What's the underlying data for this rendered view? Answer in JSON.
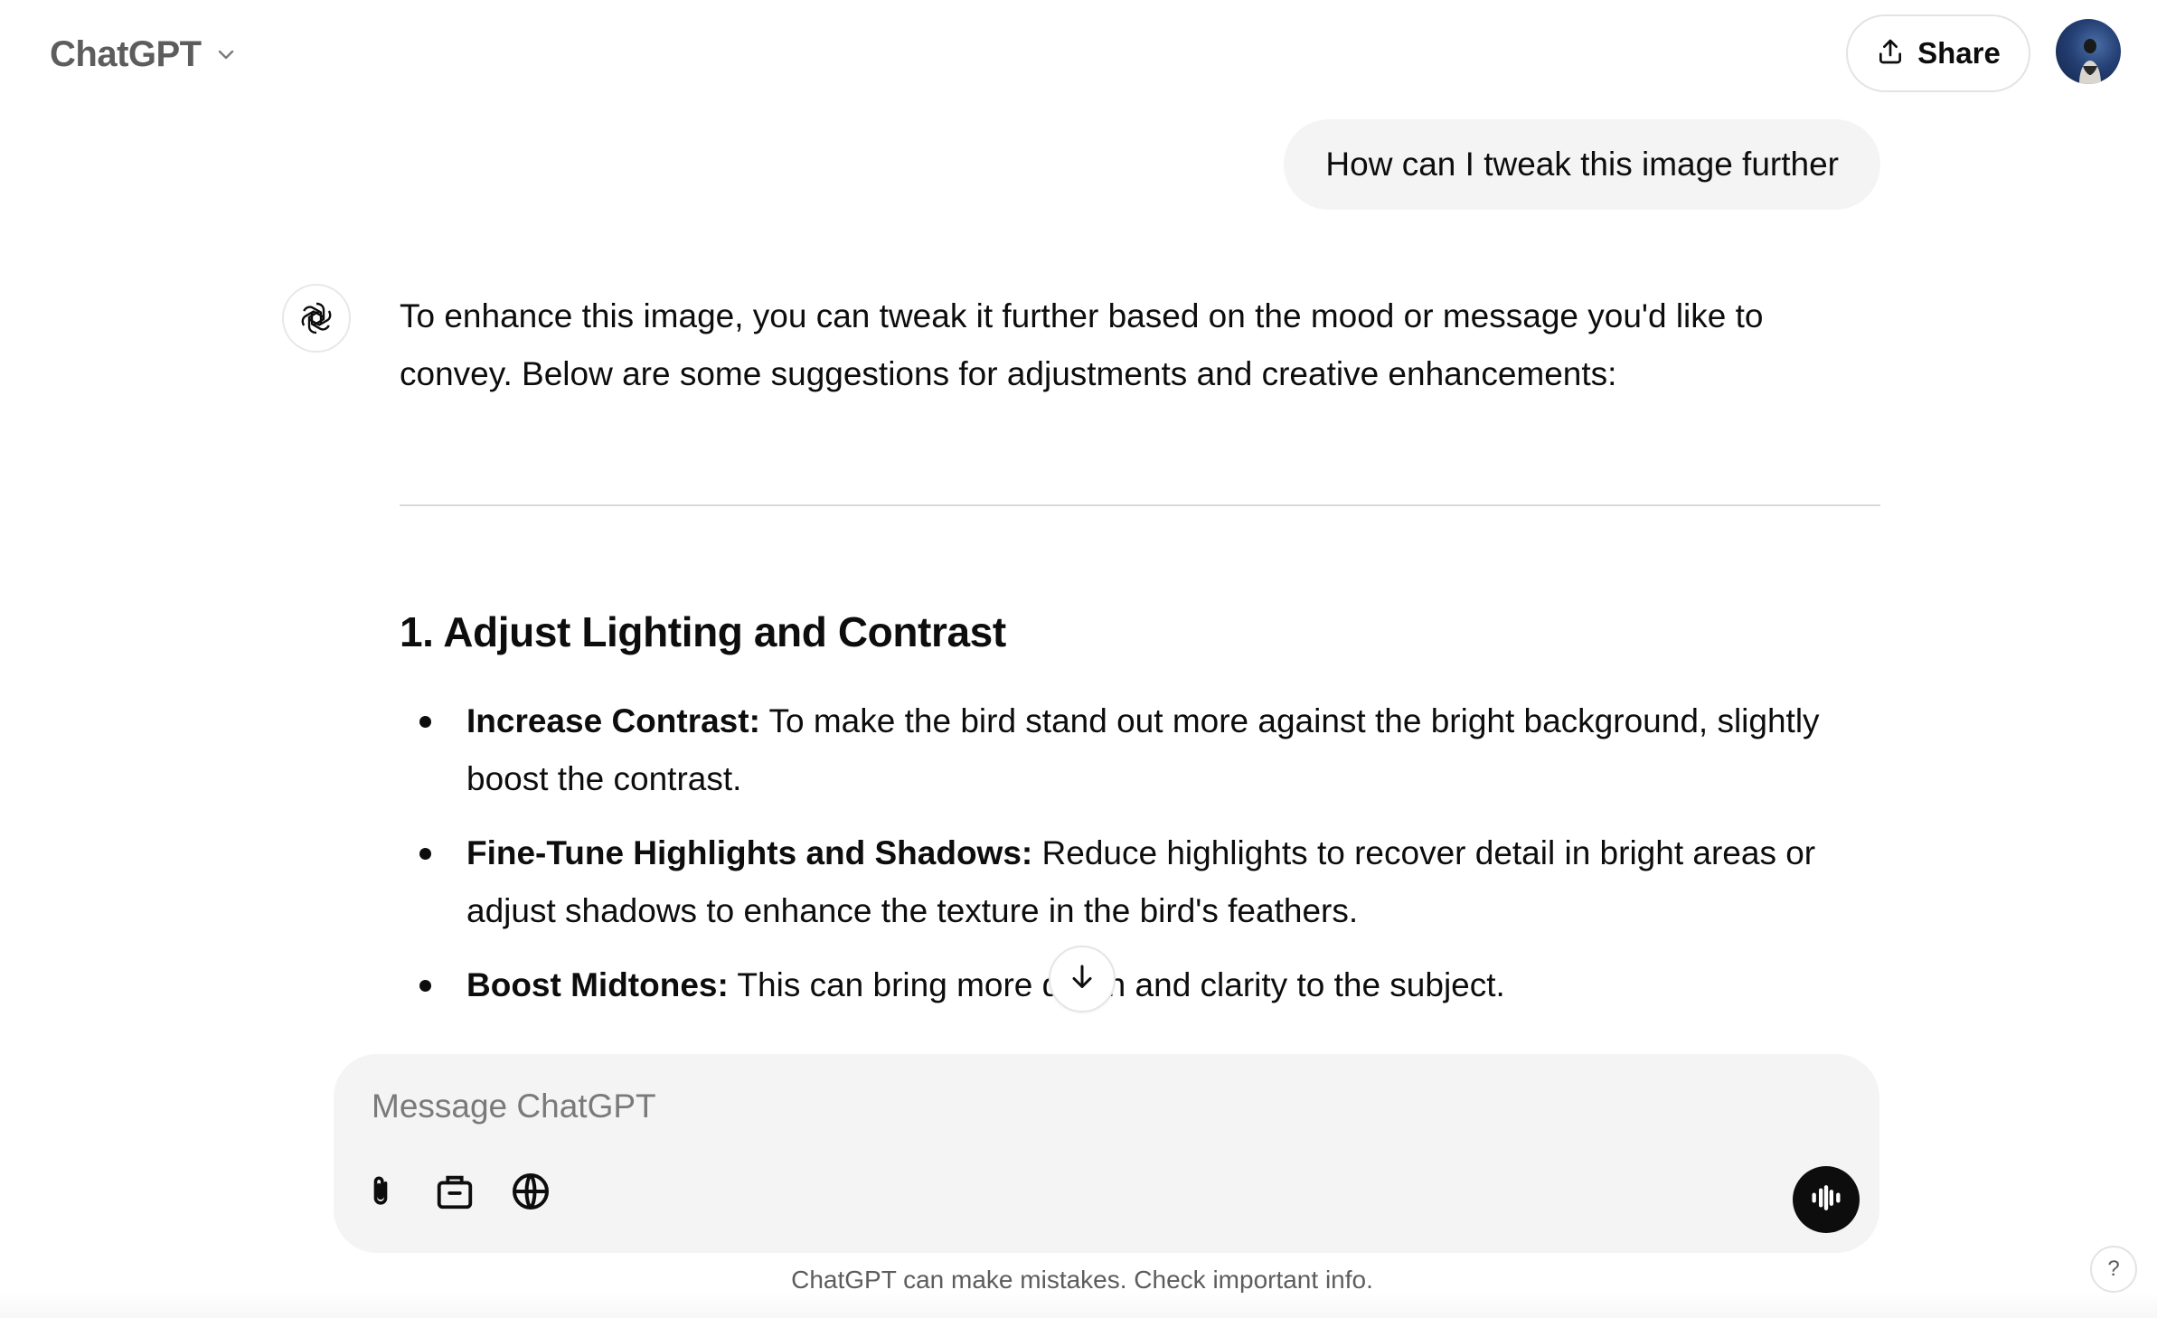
{
  "header": {
    "model_name": "ChatGPT",
    "share_label": "Share"
  },
  "conversation": {
    "user_message": "How can I tweak this image further",
    "assistant": {
      "intro": "To enhance this image, you can tweak it further based on the mood or message you'd like to convey. Below are some suggestions for adjustments and creative enhancements:",
      "section_title": "1. Adjust Lighting and Contrast",
      "items": [
        {
          "title": "Increase Contrast:",
          "text": " To make the bird stand out more against the bright background, slightly boost the contrast."
        },
        {
          "title": "Fine-Tune Highlights and Shadows:",
          "text": " Reduce highlights to recover detail in bright areas or adjust shadows to enhance the texture in the bird's feathers."
        },
        {
          "title": "Boost Midtones:",
          "text": " This can bring more depth and clarity to the subject."
        }
      ]
    }
  },
  "composer": {
    "placeholder": "Message ChatGPT"
  },
  "footer": {
    "note": "ChatGPT can make mistakes. Check important info.",
    "help_label": "?"
  },
  "icons": {
    "model_chevron": "chevron-down-icon",
    "share": "share-upload-icon",
    "assistant": "openai-logo-icon",
    "scroll": "arrow-down-icon",
    "attach": "paperclip-icon",
    "tools": "toolbox-icon",
    "web": "globe-icon",
    "voice": "voice-waveform-icon"
  }
}
